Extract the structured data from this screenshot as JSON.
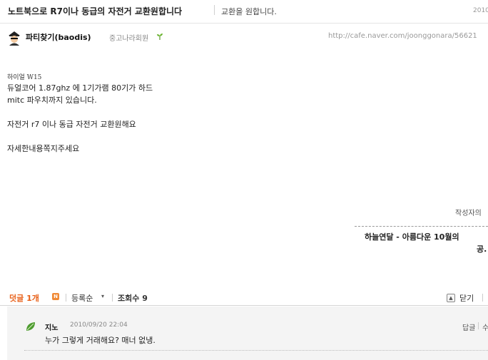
{
  "post": {
    "title": "노트북으로 R7이나 동급의 자전거 교환원합니다",
    "category": "교환을 원합니다.",
    "date_fragment": "2010"
  },
  "author": {
    "nickname": "파티찾기(baodis)",
    "grade": "중고나라회원",
    "url": "http://cafe.naver.com/joonggonara/56621"
  },
  "content": {
    "handwritten": "하이얼 W15",
    "lines": [
      "듀얼코어 1.87ghz 에 1기가램 80기가 하드",
      "mitc 파우치까지 있습니다.",
      "자전거 r7 이나 동급 자전거 교환원해요",
      "자세한내용쪽지주세요"
    ]
  },
  "author_posts": {
    "heading": "작성자의 　",
    "items": [
      "하늘연달 - 아름다운 10월의",
      "공."
    ]
  },
  "comment_bar": {
    "count_label": "덧글 1개",
    "new_badge": "N",
    "sort_label": "등록순",
    "views_label": "조회수 9",
    "close_label": "닫기"
  },
  "comments": [
    {
      "author": "지노",
      "date": "2010/09/20 22:04",
      "text": "누가 그렇게 거래해요? 매너 없냉.",
      "reply_label": "답글",
      "edit_label": "수"
    }
  ],
  "colors": {
    "accent_orange": "#e8611a",
    "comment_bg": "#f4f4f4"
  }
}
